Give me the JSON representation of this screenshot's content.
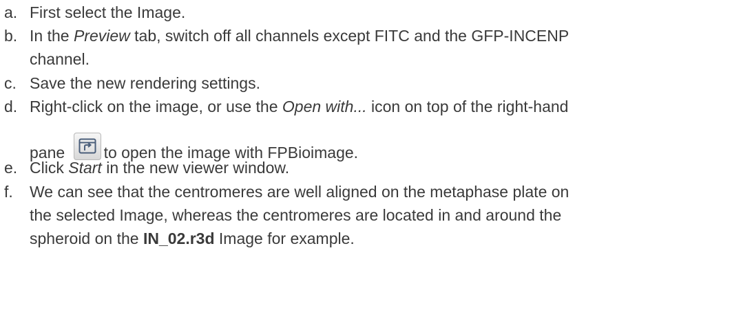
{
  "steps": [
    {
      "marker": "a.",
      "text": "First select the Image."
    },
    {
      "marker": "b.",
      "pre": "In the ",
      "em": "Preview",
      "post": " tab, switch off all channels except FITC and the GFP-INCENP",
      "line2": "channel."
    },
    {
      "marker": "c.",
      "text": "Save the new rendering settings."
    },
    {
      "marker": "d.",
      "pre": "Right-click on the image, or use the ",
      "em": "Open with...",
      "post": " icon on top of the right-hand",
      "line2_pre": "pane ",
      "icon": "open-with-icon",
      "line2_post": "to open the image with FPBioimage."
    },
    {
      "marker": "e.",
      "pre": "Click ",
      "em": "Start",
      "post": " in the new viewer window."
    },
    {
      "marker": "f.",
      "line1": "We can see that the centromeres are well aligned on the metaphase plate on",
      "line2": "the selected Image, whereas the centromeres are located in and around the",
      "line3_pre": "spheroid on the ",
      "line3_bold": "IN_02.r3d",
      "line3_post": " Image for example."
    }
  ],
  "colors": {
    "text": "#3a3a3a",
    "icon_stroke": "#4a5e7a",
    "icon_bg": "#e6e6e6"
  }
}
